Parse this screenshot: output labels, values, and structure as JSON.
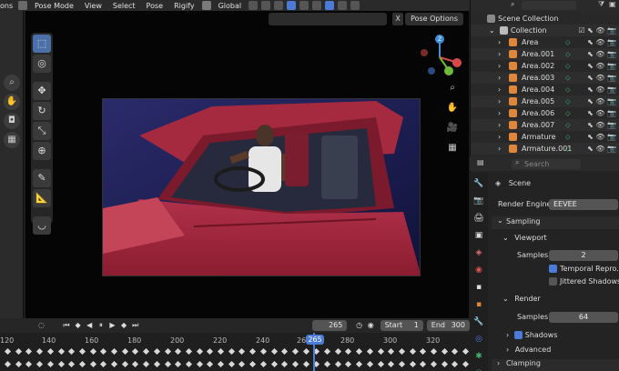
{
  "header": {
    "left_clipped": "",
    "mode": "Pose Mode",
    "menus": [
      "View",
      "Select",
      "Pose",
      "Rigify"
    ],
    "transform_orientation": "Global"
  },
  "viewport": {
    "pose_options_label": "Pose Options",
    "close_glyph": "X",
    "left_clip_label": "ons"
  },
  "outliner": {
    "title": "Scene Collection",
    "collection": "Collection",
    "items": [
      {
        "label": "Area",
        "icon": "light-icon",
        "color": "#e0863a"
      },
      {
        "label": "Area.001",
        "icon": "light-icon",
        "color": "#e0863a"
      },
      {
        "label": "Area.002",
        "icon": "light-icon",
        "color": "#e0863a"
      },
      {
        "label": "Area.003",
        "icon": "light-icon",
        "color": "#e0863a"
      },
      {
        "label": "Area.004",
        "icon": "light-icon",
        "color": "#e0863a"
      },
      {
        "label": "Area.005",
        "icon": "light-icon",
        "color": "#e0863a"
      },
      {
        "label": "Area.006",
        "icon": "light-icon",
        "color": "#e0863a"
      },
      {
        "label": "Area.007",
        "icon": "light-icon",
        "color": "#e0863a"
      },
      {
        "label": "Armature",
        "icon": "armature-icon",
        "color": "#e0863a"
      },
      {
        "label": "Armature.001",
        "icon": "armature-icon",
        "color": "#e0863a"
      }
    ]
  },
  "properties": {
    "search_placeholder": "Search",
    "scene_label": "Scene",
    "render_engine_label": "Render Engine",
    "render_engine_value": "EEVEE",
    "sampling_label": "Sampling",
    "viewport_label": "Viewport",
    "samples_label": "Samples",
    "viewport_samples": "2",
    "temporal_reprojection": "Temporal Repro...",
    "jittered_shadows": "Jittered Shadows",
    "render_label": "Render",
    "render_samples": "64",
    "shadows_label": "Shadows",
    "advanced_label": "Advanced",
    "clamping_label": "Clamping"
  },
  "timeline": {
    "current_frame": "265",
    "start_label": "Start",
    "start_value": "1",
    "end_label": "End",
    "end_value": "300",
    "ticks": [
      "120",
      "140",
      "160",
      "180",
      "200",
      "220",
      "240",
      "26",
      "280",
      "300",
      "320"
    ],
    "playhead_label": "265"
  },
  "colors": {
    "accent": "#4b7bd6",
    "light_icon": "#e0863a",
    "constraint_icon": "#3fb26a"
  }
}
